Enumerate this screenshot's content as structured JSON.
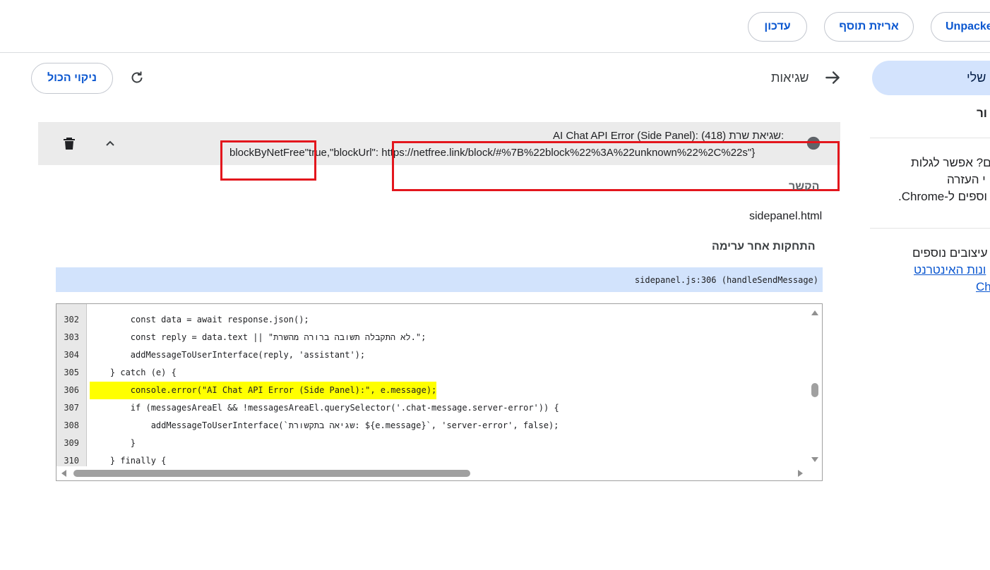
{
  "toolbar": {
    "update_label": "עדכון",
    "pack_label": "אריזת תוסף",
    "unpacked_label": "Unpacke"
  },
  "sidebar": {
    "active_item": "שלי",
    "item2": "ור",
    "paragraph1": [
      "ם? אפשר לגלות",
      "י העזרה",
      "וספים ל-Chrome."
    ],
    "paragraph2_line1": "עיצובים נוספים",
    "paragraph2_link1": "ונות האינטרנט",
    "paragraph2_link2": "Ch"
  },
  "header": {
    "title": "שגיאות",
    "clear_all_label": "ניקוי הכול"
  },
  "error": {
    "line1": "AI Chat API Error (Side Panel): שגיאת שרת (418):",
    "line2_part1": "blockByNetFree",
    "line2_part2": "\"true,\"blockUrl\":",
    "line2_part3": "https://netfree.link/block/#%7B%22block%22%3A%22unknown%22%2C%22s\"}",
    "context_label": "הקשר",
    "context_value": "sidepanel.html",
    "stack_label": "התחקות אחר ערימה",
    "stack_frame": "sidepanel.js:306 (handleSendMessage)"
  },
  "code": {
    "lines": [
      {
        "n": "302",
        "text": "        const data = await response.json();"
      },
      {
        "n": "303",
        "text": "        const reply = data.text || \"לא התקבלה תשובה ברורה מהשרת.\";"
      },
      {
        "n": "304",
        "text": "        addMessageToUserInterface(reply, 'assistant');"
      },
      {
        "n": "305",
        "text": "    } catch (e) {"
      },
      {
        "n": "306",
        "text": "        console.error(\"AI Chat API Error (Side Panel):\", e.message);"
      },
      {
        "n": "307",
        "text": "        if (messagesAreaEl && !messagesAreaEl.querySelector('.chat-message.server-error')) {"
      },
      {
        "n": "308",
        "text": "            addMessageToUserInterface(`שגיאה בתקשורת: ${e.message}`, 'server-error', false);"
      },
      {
        "n": "309",
        "text": "        }"
      },
      {
        "n": "310",
        "text": "    } finally {"
      }
    ],
    "highlight_line": "306"
  },
  "colors": {
    "accent": "#0b57d0",
    "highlight": "#ffff00",
    "annotation_box": "#e3161d",
    "frame_bar": "#d2e3fc"
  }
}
